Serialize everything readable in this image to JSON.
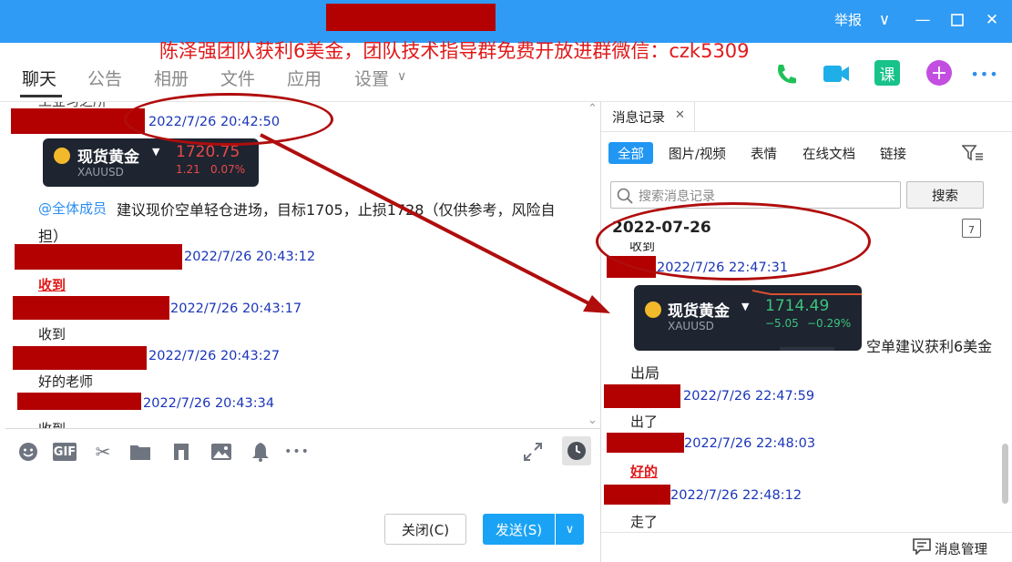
{
  "window": {
    "report_label": "举报",
    "minimize_glyph": "—",
    "maximize_glyph": "☐",
    "close_glyph": "✕",
    "dropdown_glyph": "∨"
  },
  "promo_banner": "陈泽强团队获利6美金，团队技术指导群免费开放进群微信：czk5309",
  "nav": {
    "tabs": [
      "聊天",
      "公告",
      "相册",
      "文件",
      "应用",
      "设置"
    ],
    "settings_arrow": "∨"
  },
  "top_icons": [
    "phone-icon",
    "video-icon",
    "class-icon",
    "add-icon",
    "more-icon"
  ],
  "top_icon_labels": {
    "class": "课",
    "more": "•••",
    "add": "+"
  },
  "chat": {
    "partial_top_text": "工业习之所",
    "messages": [
      {
        "time": "2022/7/26 20:42:50"
      },
      {
        "time": "2022/7/26 20:43:12",
        "text": "收到",
        "style": "red-bold"
      },
      {
        "time": "2022/7/26 20:43:17",
        "text": "收到"
      },
      {
        "time": "2022/7/26 20:43:27",
        "text": "好的老师"
      },
      {
        "time": "2022/7/26 20:43:34",
        "text": "收到",
        "partial": true
      }
    ],
    "stock_card": {
      "name": "现货黄金",
      "symbol": "XAUUSD",
      "price": "1720.75",
      "change": "1.21",
      "change_pct": "0.07%",
      "color": "#e84a4a"
    },
    "mention": "@全体成员",
    "advice_line1": "建议现价空单轻仓进场，目标1705，止损1728（仅供参考，风险自",
    "advice_line2": "担）"
  },
  "toolbar_icons": [
    "emoji-icon",
    "gif-icon",
    "scissors-icon",
    "folder-icon",
    "screenshot-icon",
    "image-icon",
    "bell-icon",
    "more-icon"
  ],
  "toolbar_gif_label": "GIF",
  "buttons": {
    "close": "关闭(C)",
    "send": "发送(S)",
    "send_dropdown": "∨"
  },
  "history": {
    "panel_title": "消息记录",
    "close_glyph": "✕",
    "filter_tabs": [
      "全部",
      "图片/视频",
      "表情",
      "在线文档",
      "链接"
    ],
    "search_placeholder": "搜索消息记录",
    "search_button": "搜索",
    "date_header": "2022-07-26",
    "calendar_day": "7",
    "partial_top_text": "收到",
    "messages": [
      {
        "time": "2022/7/26 22:47:31"
      },
      {
        "time": "2022/7/26 22:47:59",
        "text": "出了"
      },
      {
        "time": "2022/7/26 22:48:03",
        "text": "好的",
        "style": "red-bold"
      },
      {
        "time": "2022/7/26 22:48:12",
        "text": "走了"
      }
    ],
    "stock_card": {
      "name": "现货黄金",
      "symbol": "XAUUSD",
      "price": "1714.49",
      "change": "−5.05",
      "change_pct": "−0.29%",
      "color": "#3cc47c"
    },
    "card_caption_1": "空单建议获利6美金",
    "card_caption_2": "出局",
    "manage_label": "消息管理"
  },
  "colors": {
    "titlebar": "#2f9bf5",
    "redaction": "#b30000",
    "annotation": "#b00d0d",
    "timestamp": "#1a35b8",
    "send_button": "#1aa3f5"
  }
}
